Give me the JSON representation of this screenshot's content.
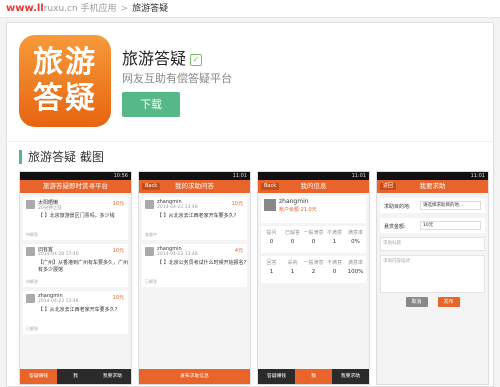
{
  "topbar": {
    "watermark": "www.ll",
    "site_crumb": "ruxu.cn 手机应用",
    "separator": ">",
    "current": "旅游答疑"
  },
  "app": {
    "icon_text_line1": "旅游",
    "icon_text_line2": "答疑",
    "name": "旅游答疑",
    "verified_badge": "✓",
    "subtitle": "网友互助有偿答疑平台",
    "download_label": "下载"
  },
  "section": {
    "title": "旅游答疑 截图"
  },
  "colors": {
    "accent_green": "#56b887",
    "brand_orange": "#e8642a"
  },
  "screens": [
    {
      "status": "10:56",
      "header": "旅游答疑即时赏寻平台",
      "items": [
        {
          "name": "太阳晒懒",
          "time": "20分钟之前",
          "reward": "10元",
          "text": "【 】北京旅游景区门票吗，多少钱",
          "footer": "待解答"
        },
        {
          "name": "旧有客",
          "time": "2014-04-29 17:46",
          "reward": "10元",
          "text": "【广州】从香港到广州有车要多久，广州有多少展馆",
          "footer": "待解答"
        },
        {
          "name": "zhangmin",
          "time": "2014-04-23 13:48",
          "reward": "10元",
          "text": "【 】从北京去江西老家开车要多久?",
          "footer": "已解答"
        }
      ],
      "tabs": [
        "答疑赚钱",
        "我",
        "我要求助"
      ]
    },
    {
      "status": "11:01",
      "back": "Back",
      "header": "我的求助问答",
      "items": [
        {
          "name": "zhangmin",
          "time": "2014-04-23 13:48",
          "reward": "10元",
          "text": "【 】从北京去江西老家开车要多久?",
          "footer": "查看中"
        },
        {
          "name": "zhangmin",
          "time": "2014-04-23 13:48",
          "reward": "4元",
          "text": "【 】北京公务员考试什么时候开始报名?",
          "footer": "已解答"
        }
      ],
      "action": "发布求助信息"
    },
    {
      "status": "11:01",
      "back": "Back",
      "header": "我的信息",
      "profile_name": "zhangmin",
      "balance": "账户余额 21.0元",
      "stats_labels": [
        "提问",
        "已解答",
        "一般满意",
        "不满意",
        "满意率"
      ],
      "stats_values": [
        "0",
        "0",
        "0",
        "1",
        "0%"
      ],
      "answer_labels": [
        "回答",
        "采纳",
        "一般满意",
        "不满意",
        "满意率"
      ],
      "answer_values": [
        "1",
        "1",
        "2",
        "0",
        "100%"
      ],
      "tabs": [
        "答疑赚钱",
        "我",
        "我要求助"
      ]
    },
    {
      "status": "11:01",
      "back": "返回",
      "header": "我要求助",
      "dest_label": "求助目的地:",
      "dest_value": "请选择求助目的地...",
      "amount_label": "悬赏金额:",
      "amount_value": "10元",
      "title_placeholder": "求助标题",
      "content_placeholder": "求助内容描述",
      "cancel": "取消",
      "submit": "发布"
    }
  ]
}
